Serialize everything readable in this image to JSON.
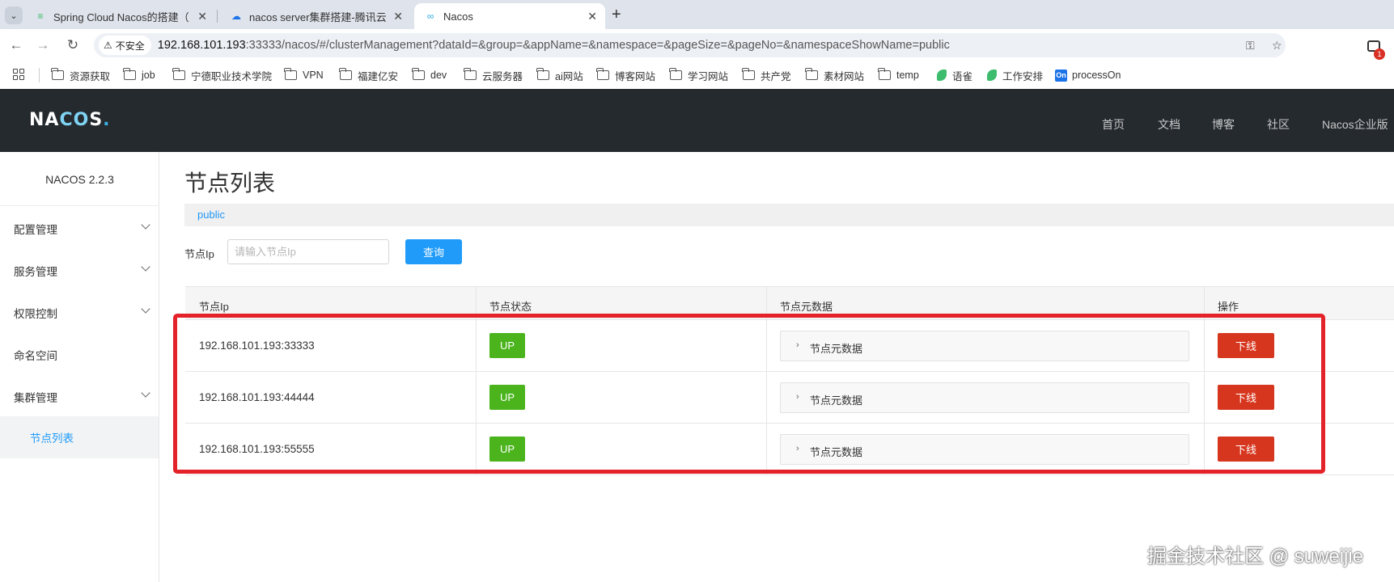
{
  "browser": {
    "tabs": [
      {
        "title": "Spring Cloud Nacos的搭建（",
        "icon": "doc-edit-icon"
      },
      {
        "title": "nacos server集群搭建-腾讯云",
        "icon": "cloud-icon"
      },
      {
        "title": "Nacos",
        "icon": "infinity-icon"
      }
    ],
    "security_label": "不安全",
    "url_host": "192.168.101.193",
    "url_path": ":33333/nacos/#/clusterManagement?dataId=&group=&appName=&namespace=&pageSize=&pageNo=&namespaceShowName=public",
    "extension_badge": "1",
    "bookmarks": [
      "资源获取",
      "job",
      "宁德职业技术学院",
      "VPN",
      "福建亿安",
      "dev",
      "云服务器",
      "ai网站",
      "博客网站",
      "学习网站",
      "共产党",
      "素材网站",
      "temp",
      "语雀",
      "工作安排",
      "processOn"
    ]
  },
  "header": {
    "logo": {
      "na": "NA",
      "co": "CO",
      "s": "S",
      "dot": "."
    },
    "nav": [
      "首页",
      "文档",
      "博客",
      "社区",
      "Nacos企业版"
    ]
  },
  "sidebar": {
    "version": "NACOS 2.2.3",
    "items": [
      {
        "label": "配置管理"
      },
      {
        "label": "服务管理"
      },
      {
        "label": "权限控制"
      },
      {
        "label": "命名空间"
      },
      {
        "label": "集群管理"
      },
      {
        "label": "节点列表"
      }
    ]
  },
  "main": {
    "title": "节点列表",
    "namespace": "public",
    "filter_label": "节点Ip",
    "filter_placeholder": "请输入节点Ip",
    "query_button": "查询",
    "columns": [
      "节点Ip",
      "节点状态",
      "节点元数据",
      "操作"
    ],
    "rows": [
      {
        "ip": "192.168.101.193:33333",
        "status": "UP",
        "meta": "节点元数据",
        "action": "下线"
      },
      {
        "ip": "192.168.101.193:44444",
        "status": "UP",
        "meta": "节点元数据",
        "action": "下线"
      },
      {
        "ip": "192.168.101.193:55555",
        "status": "UP",
        "meta": "节点元数据",
        "action": "下线"
      }
    ]
  },
  "watermark": "掘金技术社区 @ suweijie",
  "colors": {
    "header_bg": "#252a2f",
    "accent": "#209bfa",
    "status_up": "#4bb41d",
    "danger": "#d7361e",
    "highlight": "#e3222a"
  }
}
